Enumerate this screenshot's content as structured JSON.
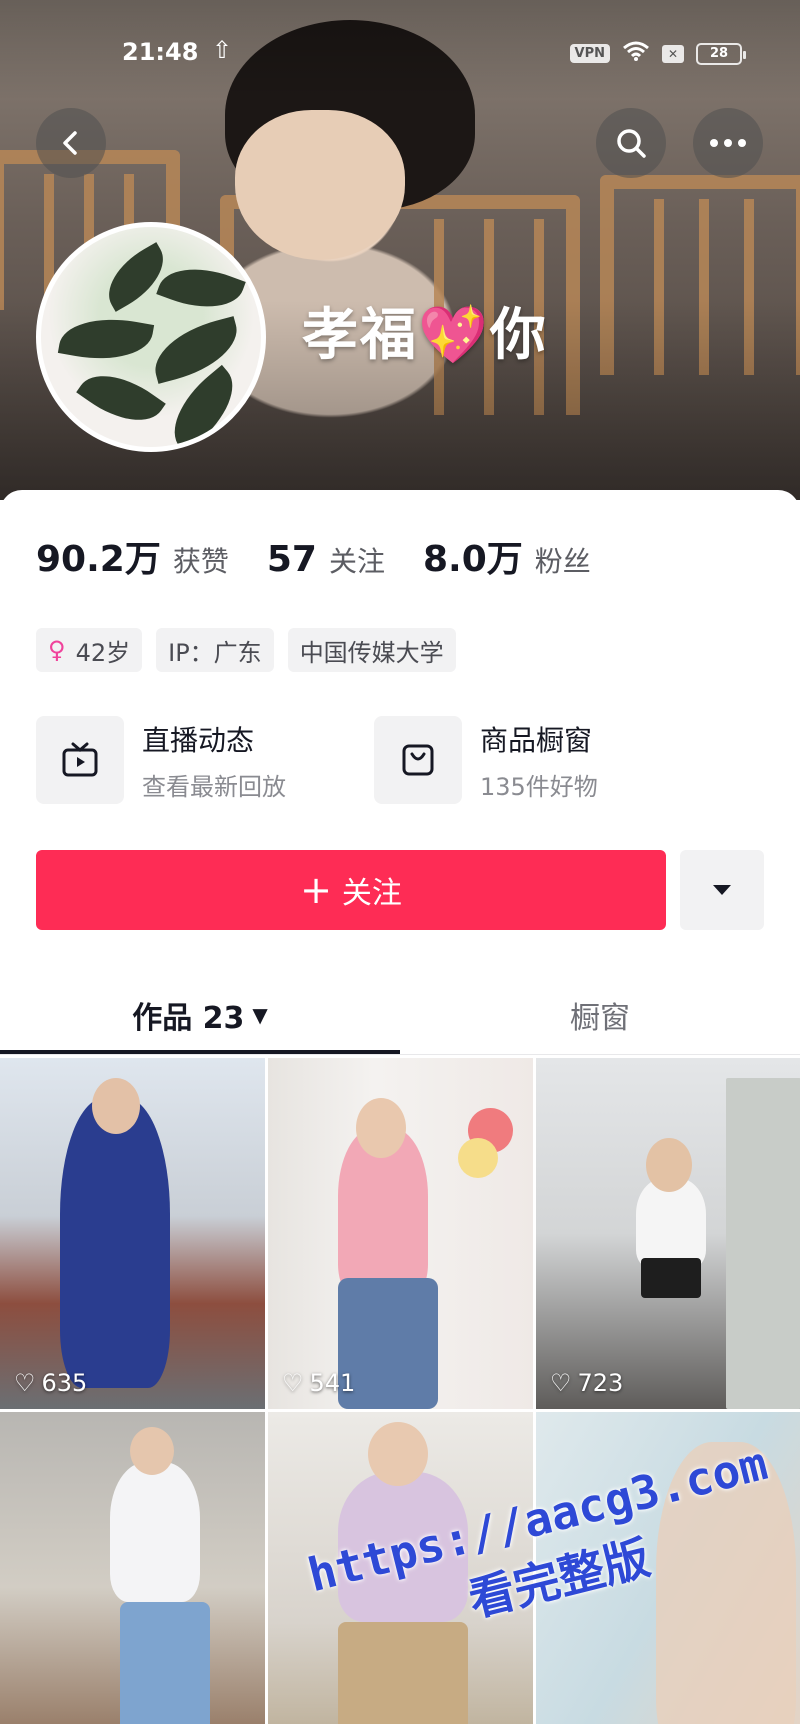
{
  "status_bar": {
    "time": "21:48",
    "vpn": "VPN",
    "battery": "28"
  },
  "profile": {
    "nickname": "孝福💖你"
  },
  "stats": [
    {
      "value": "90.2万",
      "label": "获赞"
    },
    {
      "value": "57",
      "label": "关注"
    },
    {
      "value": "8.0万",
      "label": "粉丝"
    }
  ],
  "tags": {
    "age": "42岁",
    "ip": "IP：广东",
    "school": "中国传媒大学"
  },
  "features": [
    {
      "title": "直播动态",
      "subtitle": "查看最新回放",
      "icon": "tv-icon"
    },
    {
      "title": "商品橱窗",
      "subtitle": "135件好物",
      "icon": "shopping-bag-icon"
    }
  ],
  "follow_button": {
    "label": "关注",
    "color": "#fe2c55"
  },
  "tabs": {
    "works": "作品 23",
    "showcase": "橱窗"
  },
  "videos": [
    {
      "likes": "635"
    },
    {
      "likes": "541"
    },
    {
      "likes": "723"
    },
    {
      "likes": ""
    },
    {
      "likes": ""
    },
    {
      "likes": ""
    }
  ],
  "watermark": {
    "url": "https://aacg3.com",
    "text": "看完整版"
  }
}
